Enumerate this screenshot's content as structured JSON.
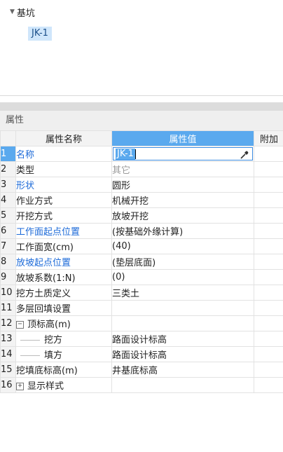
{
  "tree": {
    "root_label": "基坑",
    "child_label": "JK-1"
  },
  "panel": {
    "title": "属性"
  },
  "columns": {
    "name": "属性名称",
    "value": "属性值",
    "extra": "附加"
  },
  "rows": [
    {
      "num": "1",
      "name": "名称",
      "value": "JK-1"
    },
    {
      "num": "2",
      "name": "类型",
      "value": "其它"
    },
    {
      "num": "3",
      "name": "形状",
      "value": "圆形"
    },
    {
      "num": "4",
      "name": "作业方式",
      "value": "机械开挖"
    },
    {
      "num": "5",
      "name": "开挖方式",
      "value": "放坡开挖"
    },
    {
      "num": "6",
      "name": "工作面起点位置",
      "value": "(按基础外缘计算)"
    },
    {
      "num": "7",
      "name": "工作面宽(cm)",
      "value": "(40)"
    },
    {
      "num": "8",
      "name": "放坡起点位置",
      "value": "(垫层底面)"
    },
    {
      "num": "9",
      "name": "放坡系数(1:N)",
      "value": "(0)"
    },
    {
      "num": "10",
      "name": "挖方土质定义",
      "value": "三类土"
    },
    {
      "num": "11",
      "name": "多层回填设置",
      "value": ""
    },
    {
      "num": "12",
      "name": "顶标高(m)",
      "value": ""
    },
    {
      "num": "13",
      "name": "挖方",
      "value": "路面设计标高"
    },
    {
      "num": "14",
      "name": "填方",
      "value": "路面设计标高"
    },
    {
      "num": "15",
      "name": "挖填底标高(m)",
      "value": "井基底标高"
    },
    {
      "num": "16",
      "name": "显示样式",
      "value": ""
    }
  ],
  "expand_symbols": {
    "collapse": "−",
    "expand": "+"
  },
  "colors": {
    "accent": "#5aa9ee",
    "link_blue": "#1c6ad8",
    "muted": "#999999"
  }
}
